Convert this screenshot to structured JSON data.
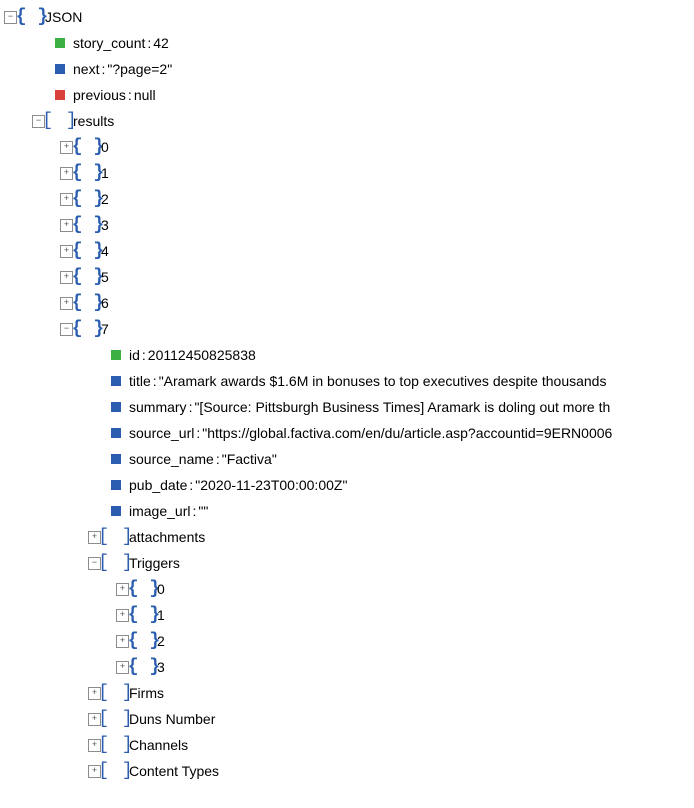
{
  "root": {
    "label": "JSON",
    "story_count_key": "story_count",
    "story_count_val": "42",
    "next_key": "next",
    "next_val": "\"?page=2\"",
    "previous_key": "previous",
    "previous_val": "null",
    "results_label": "results"
  },
  "results_indexes": [
    "0",
    "1",
    "2",
    "3",
    "4",
    "5",
    "6",
    "7"
  ],
  "item7": {
    "id_key": "id",
    "id_val": "20112450825838",
    "title_key": "title",
    "title_val": "\"Aramark awards $1.6M in bonuses to top executives despite thousands ",
    "summary_key": "summary",
    "summary_val": "\"[Source: Pittsburgh Business Times] Aramark is doling out more th",
    "source_url_key": "source_url",
    "source_url_val": "\"https://global.factiva.com/en/du/article.asp?accountid=9ERN0006",
    "source_name_key": "source_name",
    "source_name_val": "\"Factiva\"",
    "pub_date_key": "pub_date",
    "pub_date_val": "\"2020-11-23T00:00:00Z\"",
    "image_url_key": "image_url",
    "image_url_val": "\"\"",
    "attachments_label": "attachments",
    "triggers_label": "Triggers",
    "firms_label": "Firms",
    "duns_label": "Duns Number",
    "channels_label": "Channels",
    "content_types_label": "Content Types"
  },
  "triggers_indexes": [
    "0",
    "1",
    "2",
    "3"
  ],
  "glyphs": {
    "minus": "−",
    "plus": "+",
    "obj": "{ }",
    "arr": "[ ]",
    "sep": " : "
  }
}
